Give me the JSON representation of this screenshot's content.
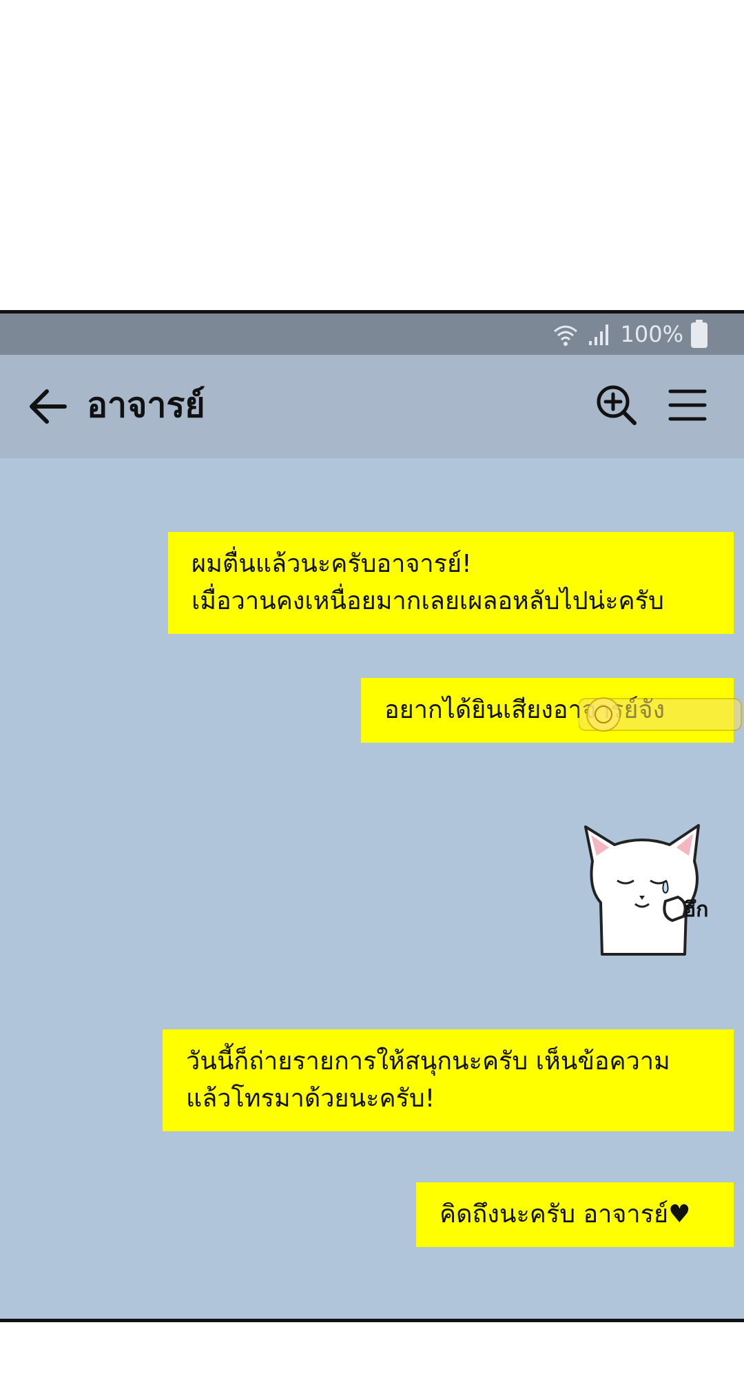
{
  "status_bar": {
    "battery_text": "100%",
    "icons": [
      "wifi-icon",
      "signal-icon",
      "battery-icon"
    ]
  },
  "header": {
    "title": "อาจารย์",
    "icons": [
      "back-arrow-icon",
      "zoom-in-icon",
      "menu-icon"
    ]
  },
  "messages": [
    {
      "lines": [
        "ผมตื่นแล้วนะครับอาจารย์!",
        "เมื่อวานคงเหนื่อยมากเลยเผลอหลับไปน่ะครับ"
      ]
    },
    {
      "lines": [
        "อยากได้ยินเสียงอาจารย์จัง"
      ]
    },
    {
      "sticker": {
        "icon": "crying-cat-sticker",
        "text": "ฮึก"
      }
    },
    {
      "lines": [
        "วันนี้ก็ถ่ายรายการให้สนุกนะครับ เห็นข้อความ",
        "แล้วโทรมาด้วยนะครับ!"
      ]
    },
    {
      "lines": [
        "คิดถึงนะครับ อาจารย์♥"
      ]
    }
  ],
  "colors": {
    "status_bar": "#7c8896",
    "header": "#a8b8ca",
    "chat_background": "#b0c4da",
    "bubble": "#ffff00"
  }
}
